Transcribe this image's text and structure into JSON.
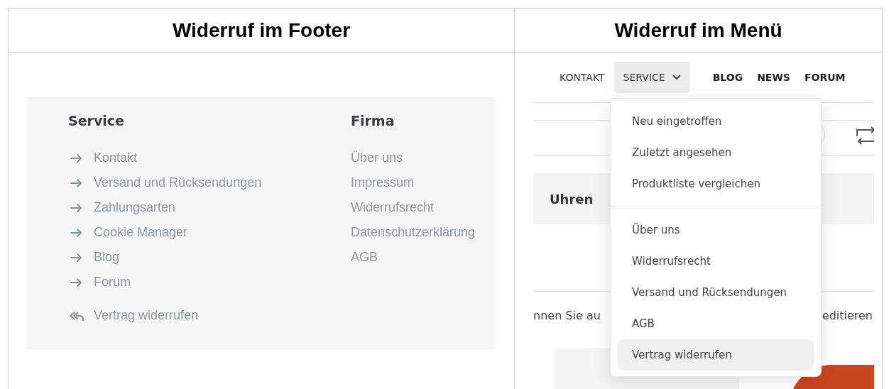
{
  "table": {
    "headers": [
      "Widerruf im Footer",
      "Widerruf im Menü"
    ]
  },
  "footer": {
    "columns": [
      {
        "title": "Service",
        "links": [
          {
            "label": "Kontakt",
            "kind": "arrow"
          },
          {
            "label": "Versand und Rücksendungen",
            "kind": "arrow"
          },
          {
            "label": "Zahlungsarten",
            "kind": "arrow"
          },
          {
            "label": "Cookie Manager",
            "kind": "arrow"
          },
          {
            "label": "Blog",
            "kind": "arrow"
          },
          {
            "label": "Forum",
            "kind": "arrow"
          },
          {
            "label": "Vertrag widerrufen",
            "kind": "revoke"
          }
        ]
      },
      {
        "title": "Firma",
        "links": [
          {
            "label": "Über uns",
            "kind": "plain"
          },
          {
            "label": "Impressum",
            "kind": "plain"
          },
          {
            "label": "Widerrufsrecht",
            "kind": "plain"
          },
          {
            "label": "Datenschutzerklärung",
            "kind": "plain"
          },
          {
            "label": "AGB",
            "kind": "plain"
          }
        ]
      }
    ]
  },
  "menu_example": {
    "nav": [
      {
        "label": "KONTAKT",
        "bold": false,
        "selected": false,
        "dropdown": false
      },
      {
        "label": "SERVICE",
        "bold": false,
        "selected": true,
        "dropdown": true
      },
      {
        "label": "BLOG",
        "bold": true,
        "selected": false,
        "dropdown": false
      },
      {
        "label": "NEWS",
        "bold": true,
        "selected": false,
        "dropdown": false
      },
      {
        "label": "FORUM",
        "bold": true,
        "selected": false,
        "dropdown": false
      }
    ],
    "category": "Uhren",
    "text_left": "nnen Sie au",
    "text_right": "editieren",
    "dropdown": {
      "groups": [
        [
          {
            "label": "Neu eingetroffen",
            "selected": false
          },
          {
            "label": "Zuletzt angesehen",
            "selected": false
          },
          {
            "label": "Produktliste vergleichen",
            "selected": false
          }
        ],
        [
          {
            "label": "Über uns",
            "selected": false
          },
          {
            "label": "Widerrufsrecht",
            "selected": false
          },
          {
            "label": "Versand und Rücksendungen",
            "selected": false
          },
          {
            "label": "AGB",
            "selected": false
          },
          {
            "label": "Vertrag widerrufen",
            "selected": true
          }
        ]
      ]
    }
  }
}
